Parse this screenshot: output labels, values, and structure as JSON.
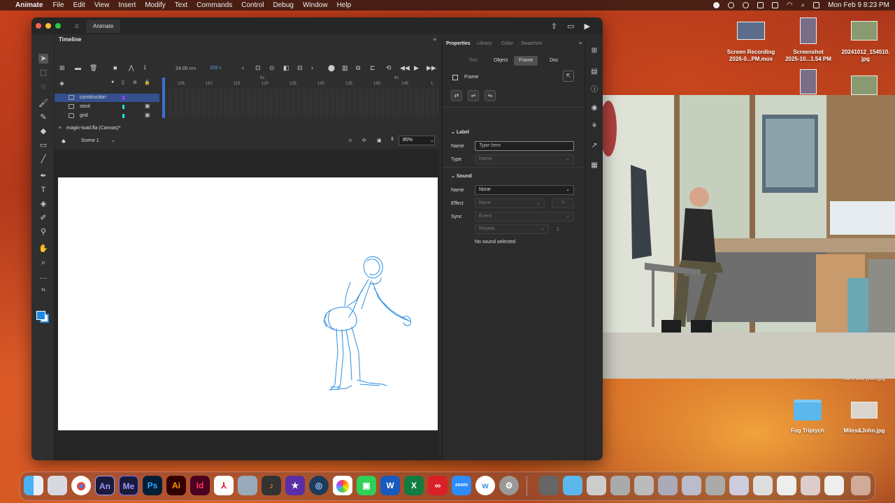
{
  "menubar": {
    "app_name": "Animate",
    "items": [
      "File",
      "Edit",
      "View",
      "Insert",
      "Modify",
      "Text",
      "Commands",
      "Control",
      "Debug",
      "Window",
      "Help"
    ],
    "clock": "Mon Feb 9  8:23 PM"
  },
  "window": {
    "home_tab": "⌂",
    "doc_tab": "Animate"
  },
  "timeline": {
    "title": "Timeline",
    "fps": "24.00",
    "fps_unit": "FPS",
    "current_frame": "102",
    "frame_unit": "F",
    "ticks": [
      "105",
      "110",
      "115",
      "120",
      "125",
      "130",
      "135",
      "140",
      "145",
      "1"
    ],
    "sec_marks": [
      "5s",
      "6s"
    ],
    "layers": [
      {
        "name": "construction",
        "color": "#a03cff",
        "selected": true
      },
      {
        "name": "stool",
        "color": "#22e0e0",
        "selected": false
      },
      {
        "name": "grid",
        "color": "#22e0e0",
        "selected": false
      }
    ]
  },
  "stage": {
    "file_tab": "magin-toad.fla (Canvas)*",
    "scene": "Scene 1",
    "zoom": "85%"
  },
  "properties": {
    "tabs": [
      "Properties",
      "Library",
      "Color",
      "Swatches"
    ],
    "subtabs": [
      "Tool",
      "Object",
      "Frame",
      "Doc"
    ],
    "active_subtab": "Frame",
    "frame_header": "Frame",
    "label_section": "Label",
    "name_label": "Name",
    "name_placeholder": "Type here",
    "type_label": "Type",
    "type_value": "Name",
    "sound_section": "Sound",
    "sound_name_label": "Name",
    "sound_name_value": "None",
    "effect_label": "Effect",
    "effect_value": "None",
    "sync_label": "Sync",
    "sync_value": "Event",
    "repeat_value": "Repeat",
    "repeat_count": "1",
    "status": "No sound selected"
  },
  "desktop": {
    "icons": [
      {
        "label": "Screen Recording\n2026-0...PM.mov"
      },
      {
        "label": "Screenshot\n2025-10...1.54 PM"
      },
      {
        "label": "20241012_154510.\njpg"
      },
      {
        "label": "Fog Triptych"
      },
      {
        "label": "Miles&John.jpg"
      }
    ],
    "partial_label": "miles and john.jpg"
  },
  "dock": {
    "apps": [
      "Finder",
      "Launchpad",
      "Chrome",
      "Animate",
      "Media Encoder",
      "Photoshop",
      "Illustrator",
      "InDesign",
      "Acrobat",
      "Preview",
      "GarageBand",
      "iMovie",
      "QuickTime",
      "Photos",
      "FaceTime",
      "Word",
      "Excel",
      "Creative Cloud",
      "Zoom",
      "Webex",
      "System Settings"
    ],
    "labels": {
      "an": "An",
      "me": "Me",
      "ps": "Ps",
      "ai": "Ai",
      "id": "Id",
      "zoom": "zoom",
      "w": "W"
    }
  },
  "colors": {
    "selection_blue": "#34508e",
    "accent_blue": "#3d6fd6",
    "sketch_blue": "#2b8de0"
  }
}
